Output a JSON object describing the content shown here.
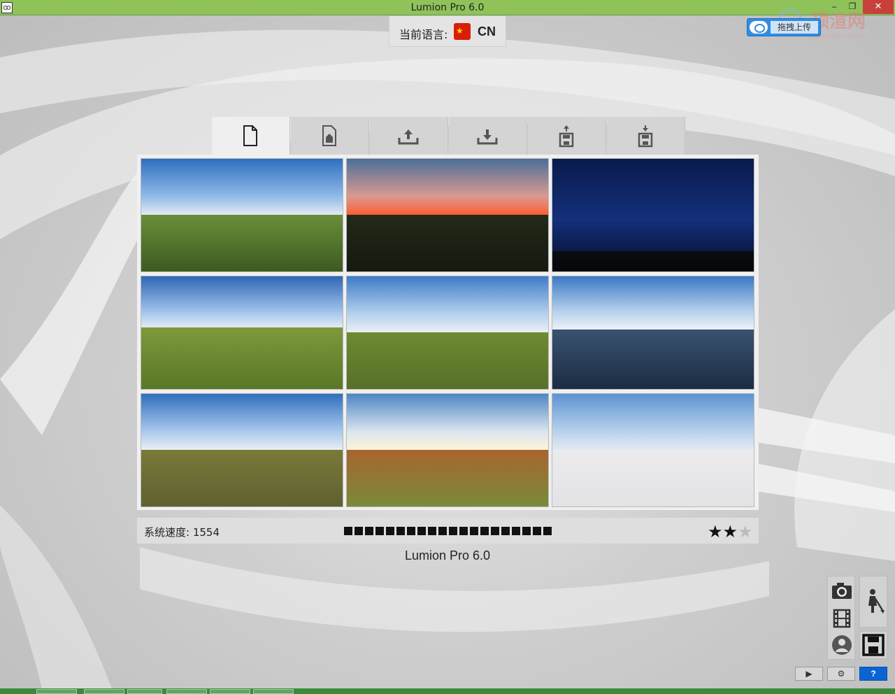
{
  "window": {
    "title": "Lumion Pro 6.0",
    "app_icon": "lumion-app-icon",
    "minimize_glyph": "–",
    "maximize_glyph": "❐",
    "close_glyph": "✕"
  },
  "language": {
    "label": "当前语言:",
    "code": "CN",
    "flag_icon": "china-flag-icon",
    "flag_glyph": "★"
  },
  "upload": {
    "label": "拖拽上传"
  },
  "watermark": {
    "text": "顶渲网",
    "sub": "toprender.com"
  },
  "tabs": [
    {
      "id": "new",
      "icon": "new-document-icon",
      "active": true
    },
    {
      "id": "example",
      "icon": "example-scene-icon",
      "active": false
    },
    {
      "id": "import",
      "icon": "upload-tray-icon",
      "active": false
    },
    {
      "id": "export",
      "icon": "download-tray-icon",
      "active": false
    },
    {
      "id": "load",
      "icon": "floppy-up-icon",
      "active": false
    },
    {
      "id": "save",
      "icon": "floppy-down-icon",
      "active": false
    }
  ],
  "scenes": [
    {
      "id": "grass-day",
      "sky": [
        "#2f6fbf",
        "#8fb9e8",
        "#e9eef5"
      ],
      "ground": [
        "#6a8f3a",
        "#3d5a22"
      ],
      "horizon": 0.5
    },
    {
      "id": "sunset",
      "sky": [
        "#4a6f99",
        "#d99a92",
        "#ff5a2a"
      ],
      "ground": [
        "#232a18",
        "#141a0e"
      ],
      "horizon": 0.5
    },
    {
      "id": "night",
      "sky": [
        "#0a1a4d",
        "#13307a",
        "#0b1a45"
      ],
      "ground": [
        "#0a0d12",
        "#050608"
      ],
      "horizon": 0.82
    },
    {
      "id": "hills-day",
      "sky": [
        "#2f66b5",
        "#9dc0ea",
        "#e9eef5"
      ],
      "ground": [
        "#7d9a3c",
        "#5a7727"
      ],
      "horizon": 0.46
    },
    {
      "id": "meadow",
      "sky": [
        "#3d7cc8",
        "#b4d0ee",
        "#eef2f6"
      ],
      "ground": [
        "#6f8a30",
        "#56702a"
      ],
      "horizon": 0.5
    },
    {
      "id": "mountain-lake",
      "sky": [
        "#3a78c5",
        "#b8d2ee",
        "#f1f4f7"
      ],
      "ground": [
        "#3a5270",
        "#1c2c44"
      ],
      "horizon": 0.48
    },
    {
      "id": "coast-field",
      "sky": [
        "#2f6fbe",
        "#a9c8ec",
        "#eef2f6"
      ],
      "ground": [
        "#7a7a3a",
        "#5f6030"
      ],
      "horizon": 0.5
    },
    {
      "id": "desert-sun",
      "sky": [
        "#4d86c4",
        "#d9e4ee",
        "#fff6d8"
      ],
      "ground": [
        "#a8652f",
        "#7a8a3a"
      ],
      "horizon": 0.5
    },
    {
      "id": "blank-sky",
      "sky": [
        "#5c93d2",
        "#b7d1ec",
        "#e7ecf2"
      ],
      "ground": [
        "#ebebed",
        "#e3e3e6"
      ],
      "horizon": 0.5
    }
  ],
  "status": {
    "speed_label": "系统速度: 1554",
    "speed_segments": 20,
    "rating": 2,
    "rating_max": 3,
    "star_glyph": "★"
  },
  "footer": {
    "version": "Lumion Pro 6.0"
  },
  "tools": {
    "camera_icon": "camera-icon",
    "film_icon": "film-icon",
    "avatar_icon": "avatar-icon",
    "build_icon": "worker-icon",
    "save_icon": "floppy-save-icon",
    "play_glyph": "▶",
    "settings_glyph": "⚙",
    "help_glyph": "?"
  },
  "colors": {
    "titlebar": "#8fc35a",
    "panel": "#f0f0f0",
    "accent": "#0b64d4"
  }
}
